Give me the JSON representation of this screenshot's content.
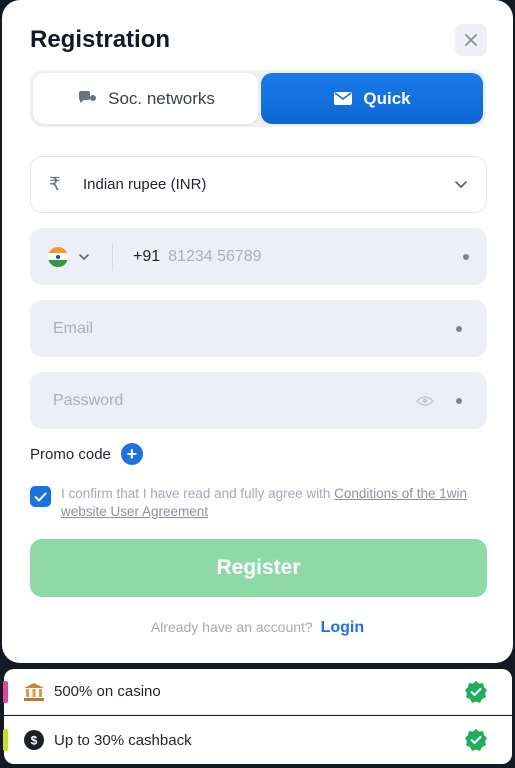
{
  "header": {
    "title": "Registration"
  },
  "tabs": {
    "social_label": "Soc. networks",
    "quick_label": "Quick",
    "active": "Quick"
  },
  "currency": {
    "label": "Indian rupee (INR)",
    "symbol": "₹"
  },
  "phone": {
    "code": "+91",
    "placeholder": "81234 56789"
  },
  "email": {
    "placeholder": "Email"
  },
  "password": {
    "placeholder": "Password"
  },
  "promo": {
    "label": "Promo code",
    "plus": "+"
  },
  "agreement": {
    "text": "I confirm that I have read and fully agree with ",
    "link": "Conditions of the 1win website User Agreement",
    "checked": true
  },
  "register": {
    "label": "Register"
  },
  "login": {
    "prompt": "Already have an account?",
    "link": "Login"
  },
  "bonuses": [
    {
      "text": "500% on casino",
      "icon": "casino-bank-icon",
      "accent": "#e040a0"
    },
    {
      "text": "Up to 30% cashback",
      "icon": "cashback-dollar-icon",
      "accent": "#c8e020"
    }
  ],
  "colors": {
    "primary": "#1a73e0",
    "register_disabled": "#8fd9a8",
    "check_green": "#1fae5b"
  }
}
